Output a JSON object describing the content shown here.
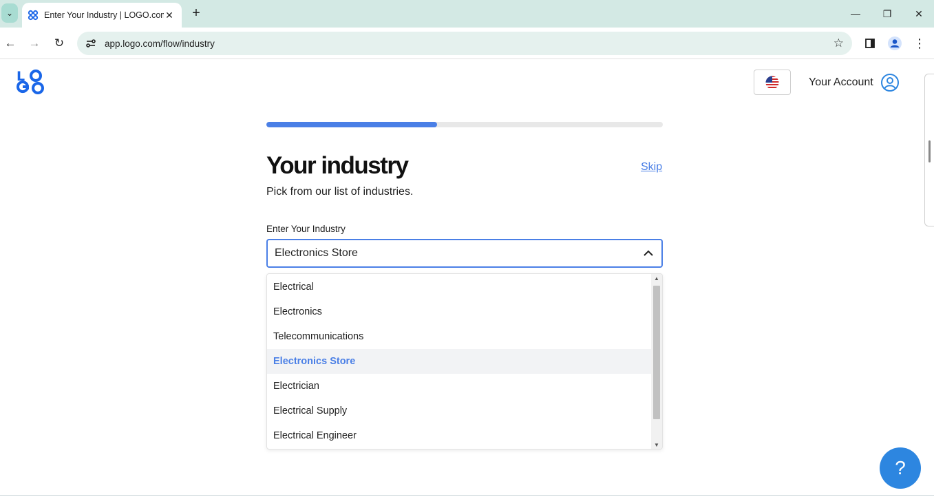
{
  "browser": {
    "tab_title": "Enter Your Industry | LOGO.com",
    "url": "app.logo.com/flow/industry",
    "tab_close_glyph": "✕",
    "new_tab_glyph": "+",
    "minimize_glyph": "—",
    "restore_glyph": "❐",
    "close_glyph": "✕",
    "back_glyph": "←",
    "forward_glyph": "→",
    "reload_glyph": "↻",
    "star_glyph": "☆",
    "menu_glyph": "⋮",
    "tab_search_glyph": "⌄"
  },
  "header": {
    "account_label": "Your Account",
    "language_flag_icon": "us-flag-icon"
  },
  "progress": {
    "percent": 43
  },
  "main": {
    "title": "Your industry",
    "subtitle": "Pick from our list of industries.",
    "skip_label": "Skip",
    "field_label": "Enter Your Industry",
    "field_value": "Electronics Store"
  },
  "dropdown": {
    "options": [
      {
        "label": "Electrical",
        "active": false
      },
      {
        "label": "Electronics",
        "active": false
      },
      {
        "label": "Telecommunications",
        "active": false
      },
      {
        "label": "Electronics Store",
        "active": true
      },
      {
        "label": "Electrician",
        "active": false
      },
      {
        "label": "Electrical Supply",
        "active": false
      },
      {
        "label": "Electrical Engineer",
        "active": false
      }
    ]
  },
  "help": {
    "label": "?"
  },
  "colors": {
    "accent": "#4a7fe6",
    "help_button": "#2d86e0",
    "tabbar": "#d3e9e4"
  }
}
